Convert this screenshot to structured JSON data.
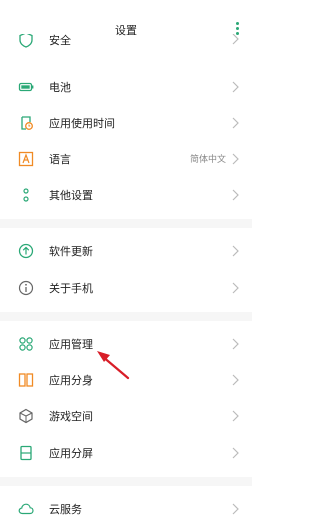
{
  "header": {
    "title": "设置",
    "more_icon": "more-vertical-icon"
  },
  "colors": {
    "accent": "#2aa876",
    "arrow": "#d81e28",
    "separator": "#f6f6f6"
  },
  "group1": [
    {
      "label": "安全",
      "icon": "shield-icon",
      "value": ""
    },
    {
      "label": "电池",
      "icon": "battery-icon",
      "value": ""
    },
    {
      "label": "应用使用时间",
      "icon": "app-usage-icon",
      "value": ""
    },
    {
      "label": "语言",
      "icon": "language-icon",
      "value": "简体中文"
    },
    {
      "label": "其他设置",
      "icon": "other-settings-icon",
      "value": ""
    }
  ],
  "group2": [
    {
      "label": "软件更新",
      "icon": "software-update-icon"
    },
    {
      "label": "关于手机",
      "icon": "info-icon"
    }
  ],
  "group3": [
    {
      "label": "应用管理",
      "icon": "app-management-icon"
    },
    {
      "label": "应用分身",
      "icon": "app-clone-icon"
    },
    {
      "label": "游戏空间",
      "icon": "game-space-icon"
    },
    {
      "label": "应用分屏",
      "icon": "split-screen-icon"
    }
  ],
  "group4": [
    {
      "label": "云服务",
      "icon": "cloud-icon"
    }
  ]
}
